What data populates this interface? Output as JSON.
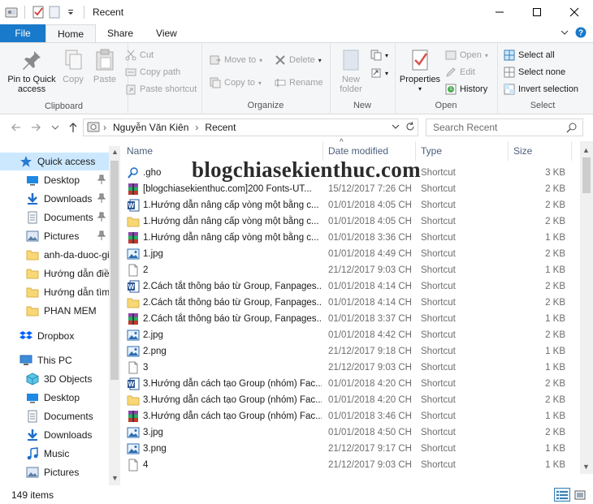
{
  "window": {
    "title": "Recent",
    "buttons": {
      "minimize": "—",
      "maximize": "☐",
      "close": "✕"
    }
  },
  "tabs": [
    {
      "label": "File"
    },
    {
      "label": "Home"
    },
    {
      "label": "Share"
    },
    {
      "label": "View"
    }
  ],
  "ribbon": {
    "clipboard": {
      "label": "Clipboard",
      "pin": "Pin to Quick access",
      "copy": "Copy",
      "paste": "Paste",
      "cut": "Cut",
      "copy_path": "Copy path",
      "paste_shortcut": "Paste shortcut"
    },
    "organize": {
      "label": "Organize",
      "move_to": "Move to",
      "copy_to": "Copy to",
      "delete": "Delete",
      "rename": "Rename"
    },
    "new": {
      "label": "New",
      "new_folder": "New folder"
    },
    "open": {
      "label": "Open",
      "properties": "Properties",
      "open": "Open",
      "edit": "Edit",
      "history": "History"
    },
    "select": {
      "label": "Select",
      "select_all": "Select all",
      "select_none": "Select none",
      "invert": "Invert selection"
    }
  },
  "address": {
    "crumbs": [
      "Nguyễn Văn Kiên",
      "Recent"
    ],
    "search_placeholder": "Search Recent"
  },
  "nav": [
    {
      "label": "Quick access",
      "icon": "star-icon",
      "selected": true
    },
    {
      "label": "Desktop",
      "icon": "desktop-icon",
      "pinned": true
    },
    {
      "label": "Downloads",
      "icon": "download-icon",
      "pinned": true
    },
    {
      "label": "Documents",
      "icon": "documents-icon",
      "pinned": true
    },
    {
      "label": "Pictures",
      "icon": "pictures-icon",
      "pinned": true
    },
    {
      "label": "anh-da-duoc-gi",
      "icon": "folder-icon"
    },
    {
      "label": "Hướng dẫn điều",
      "icon": "folder-icon"
    },
    {
      "label": "Hướng dẫn tìm c",
      "icon": "folder-icon"
    },
    {
      "label": "PHAN MEM",
      "icon": "folder-icon"
    },
    {
      "label": "Dropbox",
      "icon": "dropbox-icon"
    },
    {
      "label": "This PC",
      "icon": "pc-icon"
    },
    {
      "label": "3D Objects",
      "icon": "3d-objects-icon"
    },
    {
      "label": "Desktop",
      "icon": "desktop-icon"
    },
    {
      "label": "Documents",
      "icon": "documents-icon"
    },
    {
      "label": "Downloads",
      "icon": "download-icon"
    },
    {
      "label": "Music",
      "icon": "music-icon"
    },
    {
      "label": "Pictures",
      "icon": "pictures-icon"
    }
  ],
  "columns": {
    "name": "Name",
    "date": "Date modified",
    "type": "Type",
    "size": "Size"
  },
  "files": [
    {
      "name": ".gho",
      "date": "",
      "type": "Shortcut",
      "size": "3 KB",
      "icon": "search-file-icon"
    },
    {
      "name": "[blogchiasekienthuc.com]200 Fonts-UT...",
      "date": "15/12/2017 7:26 CH",
      "type": "Shortcut",
      "size": "2 KB",
      "icon": "winrar-icon"
    },
    {
      "name": "1.Hướng dẫn nâng cấp vòng một bằng c...",
      "date": "01/01/2018 4:05 CH",
      "type": "Shortcut",
      "size": "2 KB",
      "icon": "word-icon"
    },
    {
      "name": "1.Hướng dẫn nâng cấp vòng một bằng c...",
      "date": "01/01/2018 4:05 CH",
      "type": "Shortcut",
      "size": "2 KB",
      "icon": "folder-icon"
    },
    {
      "name": "1.Hướng dẫn nâng cấp vòng một bằng c...",
      "date": "01/01/2018 3:36 CH",
      "type": "Shortcut",
      "size": "1 KB",
      "icon": "winrar-icon"
    },
    {
      "name": "1.jpg",
      "date": "01/01/2018 4:49 CH",
      "type": "Shortcut",
      "size": "2 KB",
      "icon": "image-icon"
    },
    {
      "name": "2",
      "date": "21/12/2017 9:03 CH",
      "type": "Shortcut",
      "size": "1 KB",
      "icon": "file-icon"
    },
    {
      "name": "2.Cách tắt thông báo từ Group, Fanpages...",
      "date": "01/01/2018 4:14 CH",
      "type": "Shortcut",
      "size": "2 KB",
      "icon": "word-icon"
    },
    {
      "name": "2.Cách tắt thông báo từ Group, Fanpages...",
      "date": "01/01/2018 4:14 CH",
      "type": "Shortcut",
      "size": "2 KB",
      "icon": "folder-icon"
    },
    {
      "name": "2.Cách tắt thông báo từ Group, Fanpages...",
      "date": "01/01/2018 3:37 CH",
      "type": "Shortcut",
      "size": "1 KB",
      "icon": "winrar-icon"
    },
    {
      "name": "2.jpg",
      "date": "01/01/2018 4:42 CH",
      "type": "Shortcut",
      "size": "2 KB",
      "icon": "image-icon"
    },
    {
      "name": "2.png",
      "date": "21/12/2017 9:18 CH",
      "type": "Shortcut",
      "size": "1 KB",
      "icon": "image-icon"
    },
    {
      "name": "3",
      "date": "21/12/2017 9:03 CH",
      "type": "Shortcut",
      "size": "1 KB",
      "icon": "file-icon"
    },
    {
      "name": "3.Hướng dẫn cách tạo Group (nhóm) Fac...",
      "date": "01/01/2018 4:20 CH",
      "type": "Shortcut",
      "size": "2 KB",
      "icon": "word-icon"
    },
    {
      "name": "3.Hướng dẫn cách tạo Group (nhóm) Fac...",
      "date": "01/01/2018 4:20 CH",
      "type": "Shortcut",
      "size": "2 KB",
      "icon": "folder-icon"
    },
    {
      "name": "3.Hướng dẫn cách tạo Group (nhóm) Fac...",
      "date": "01/01/2018 3:46 CH",
      "type": "Shortcut",
      "size": "1 KB",
      "icon": "winrar-icon"
    },
    {
      "name": "3.jpg",
      "date": "01/01/2018 4:50 CH",
      "type": "Shortcut",
      "size": "2 KB",
      "icon": "image-icon"
    },
    {
      "name": "3.png",
      "date": "21/12/2017 9:17 CH",
      "type": "Shortcut",
      "size": "1 KB",
      "icon": "image-icon"
    },
    {
      "name": "4",
      "date": "21/12/2017 9:03 CH",
      "type": "Shortcut",
      "size": "1 KB",
      "icon": "file-icon"
    }
  ],
  "watermark": "blogchiasekienthuc.com",
  "status": {
    "count": "149 items"
  },
  "colors": {
    "accent": "#1979ca",
    "selection": "#cce8ff"
  }
}
